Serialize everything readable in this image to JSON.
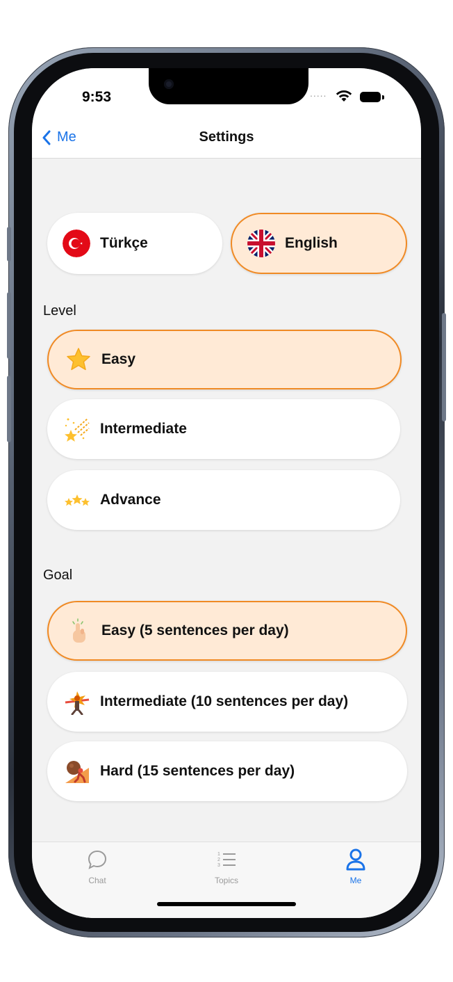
{
  "status_bar": {
    "time": "9:53",
    "signal_dots": "....."
  },
  "nav": {
    "back_label": "Me",
    "title": "Settings"
  },
  "languages": [
    {
      "label": "Türkçe",
      "flag": "turkey-flag-icon",
      "selected": false
    },
    {
      "label": "English",
      "flag": "uk-flag-icon",
      "selected": true
    }
  ],
  "level": {
    "heading": "Level",
    "options": [
      {
        "label": "Easy",
        "icon": "star-icon",
        "selected": true
      },
      {
        "label": "Intermediate",
        "icon": "sparkle-stars-icon",
        "selected": false
      },
      {
        "label": "Advance",
        "icon": "three-stars-icon",
        "selected": false
      }
    ]
  },
  "goal": {
    "heading": "Goal",
    "options": [
      {
        "label": "Easy (5 sentences per day)",
        "icon": "tapping-hand-icon",
        "selected": true
      },
      {
        "label": "Intermediate (10 sentences per day)",
        "icon": "finish-line-runner-icon",
        "selected": false
      },
      {
        "label": "Hard (15 sentences per day)",
        "icon": "pushing-boulder-icon",
        "selected": false
      }
    ]
  },
  "tabs": [
    {
      "label": "Chat",
      "icon": "chat-bubble-icon",
      "active": false
    },
    {
      "label": "Topics",
      "icon": "numbered-list-icon",
      "active": false
    },
    {
      "label": "Me",
      "icon": "person-icon",
      "active": true
    }
  ],
  "colors": {
    "accent": "#f08a24",
    "selected_bg": "#ffead6",
    "link": "#1a73e8",
    "background": "#f2f2f2"
  }
}
